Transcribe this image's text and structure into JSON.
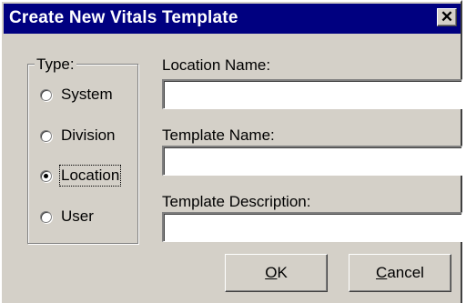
{
  "dialog": {
    "title": "Create New Vitals Template",
    "close_symbol": "✕"
  },
  "type_group": {
    "legend": "Type:",
    "options": [
      {
        "label": "System",
        "checked": false
      },
      {
        "label": "Division",
        "checked": false
      },
      {
        "label": "Location",
        "checked": true
      },
      {
        "label": "User",
        "checked": false
      }
    ]
  },
  "fields": {
    "location_name_label": "Location Name:",
    "location_name_value": "",
    "template_name_label": "Template Name:",
    "template_name_value": "",
    "template_description_label": "Template Description:",
    "template_description_value": ""
  },
  "buttons": {
    "ok_mnemonic": "O",
    "ok_rest": "K",
    "cancel_mnemonic": "C",
    "cancel_rest": "ancel"
  }
}
